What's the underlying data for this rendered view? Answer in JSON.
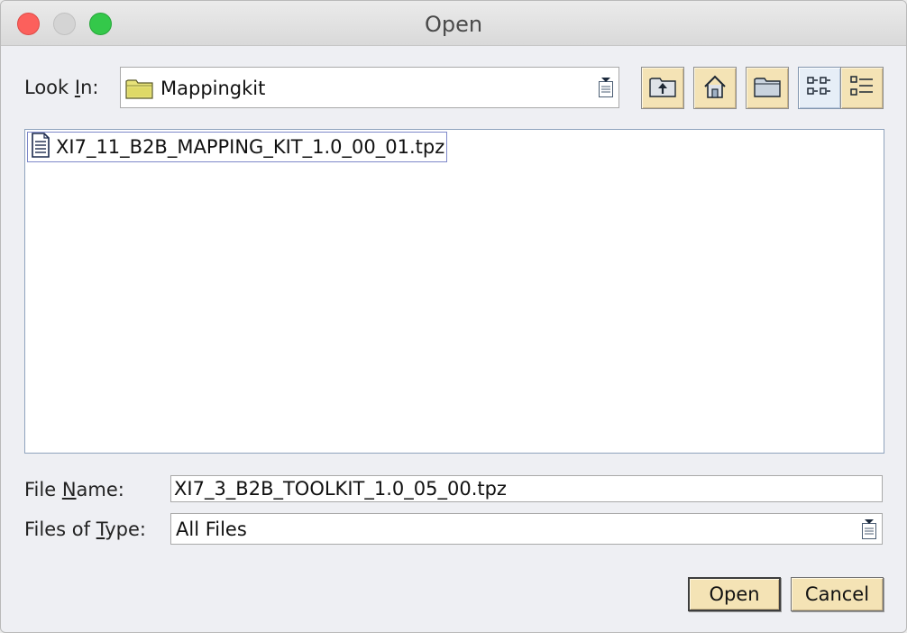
{
  "window": {
    "title": "Open"
  },
  "look_in": {
    "label_pre": "Look ",
    "label_mnemonic": "I",
    "label_post": "n:",
    "value": "Mappingkit"
  },
  "toolbar": {
    "buttons": [
      {
        "name": "up-one-level",
        "icon": "folder-up-icon"
      },
      {
        "name": "home",
        "icon": "home-icon"
      },
      {
        "name": "new-folder",
        "icon": "new-folder-icon"
      },
      {
        "name": "list-view",
        "icon": "list-view-icon",
        "active": true
      },
      {
        "name": "details-view",
        "icon": "details-view-icon"
      }
    ]
  },
  "files": [
    {
      "name": "XI7_11_B2B_MAPPING_KIT_1.0_00_01.tpz",
      "icon": "document-icon"
    }
  ],
  "file_name": {
    "label_pre": "File ",
    "label_mnemonic": "N",
    "label_post": "ame:",
    "value": "XI7_3_B2B_TOOLKIT_1.0_05_00.tpz"
  },
  "file_type": {
    "label_pre": "Files of ",
    "label_mnemonic": "T",
    "label_post": "ype:",
    "value": "All Files"
  },
  "buttons": {
    "open": "Open",
    "cancel": "Cancel"
  }
}
